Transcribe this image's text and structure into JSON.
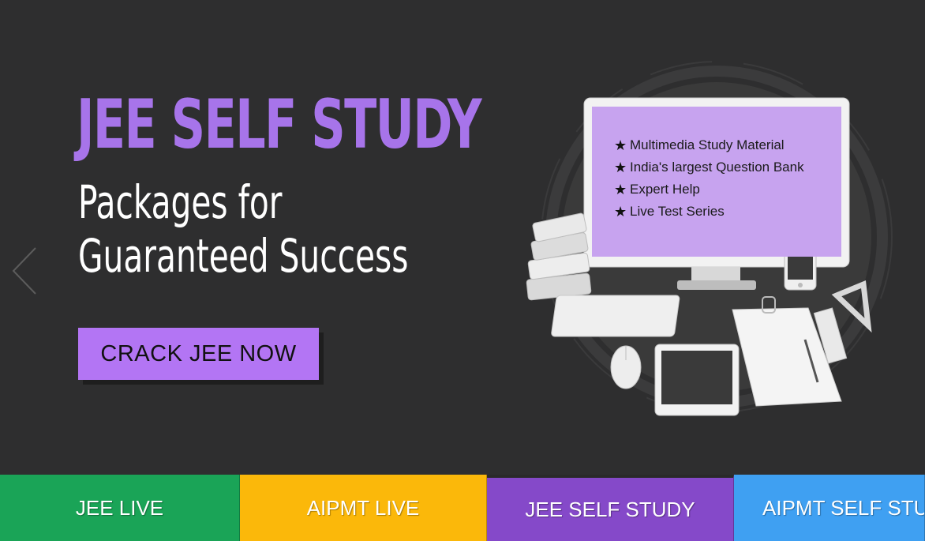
{
  "hero": {
    "headline": "JEE SELF STUDY",
    "subline_1": "Packages for",
    "subline_2": "Guaranteed Success",
    "cta_label": "CRACK JEE NOW",
    "features": [
      "Multimedia Study Material",
      "India's largest Question Bank",
      "Expert Help",
      "Live Test Series"
    ],
    "feature_bullet": "★"
  },
  "tabs": [
    {
      "label": "JEE LIVE",
      "color": "#1aa457"
    },
    {
      "label": "AIPMT LIVE",
      "color": "#fbb80a"
    },
    {
      "label": "JEE SELF STUDY",
      "color": "#8549c9",
      "active": true
    },
    {
      "label": "AIPMT SELF STUDY",
      "color": "#3fa0f2"
    }
  ],
  "colors": {
    "background": "#2e2e2f",
    "accent": "#a774ea",
    "cta": "#b375f4",
    "screen": "#c7a3ef"
  },
  "icons": {
    "prev": "chevron-left-icon"
  }
}
